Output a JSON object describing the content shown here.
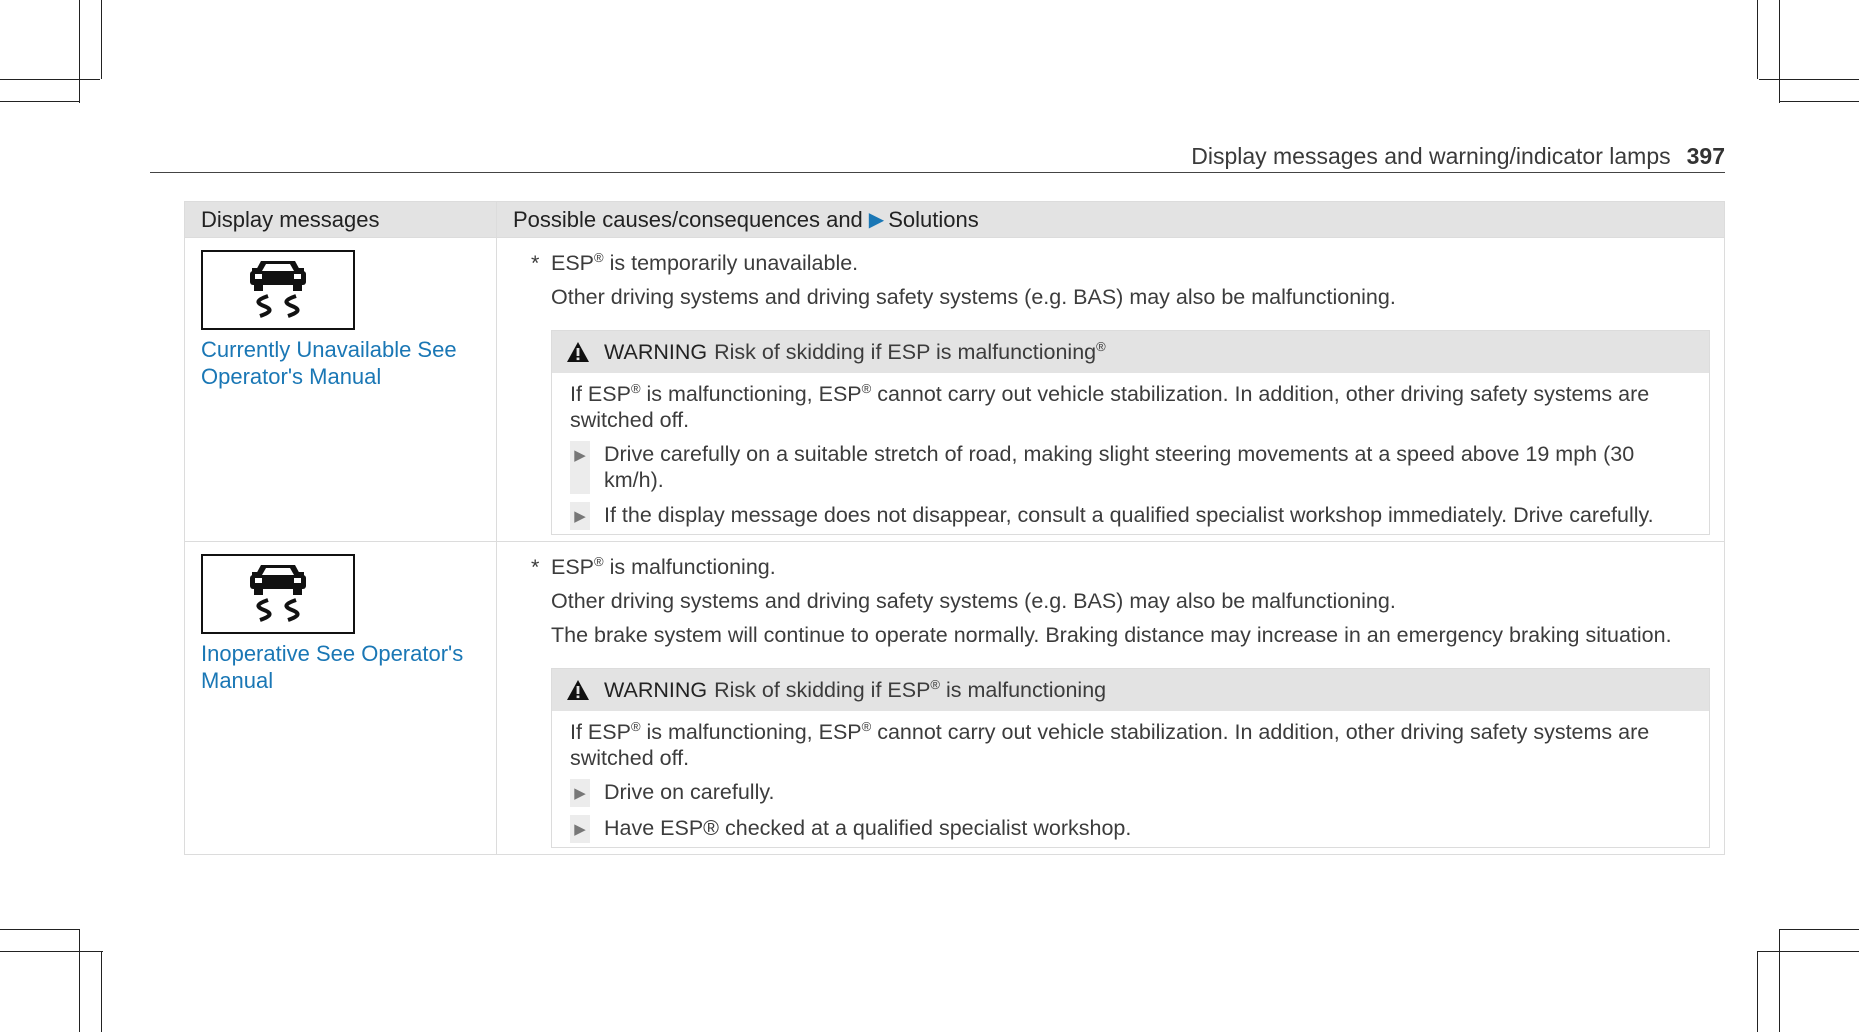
{
  "running_head": {
    "title": "Display messages and warning/indicator lamps",
    "page_number": "397"
  },
  "table": {
    "col1_header": "Display messages",
    "col2_header_pre": "Possible causes/consequences and",
    "col2_header_post": "Solutions",
    "rows": [
      {
        "icon": "esp-skid-car-icon",
        "message": "Currently Unavailable See Operator's Manual",
        "star": "*",
        "p1_pre": "ESP",
        "p1_post": " is temporarily unavailable.",
        "p2": "Other driving systems and driving safety systems (e.g. BAS) may also be malfunctioning.",
        "warning": {
          "label": "WARNING",
          "text_pre": "Risk of skidding if ESP is malfunctioning",
          "text_post": "",
          "body_a": "If ESP",
          "body_b": " is malfunctioning, ESP",
          "body_c": " cannot carry out vehicle stabilization. In addition, other driving safety systems are switched off.",
          "bullets": [
            "Drive carefully on a suitable stretch of road, making slight steering movements at a speed above 19 mph (30 km/h).",
            "If the display message does not disappear, consult a qualified specialist workshop immediately. Drive care­fully."
          ]
        }
      },
      {
        "icon": "esp-skid-car-icon",
        "message": "Inoperative See Operator's Manual",
        "star": "*",
        "p1_pre": "ESP",
        "p1_post": " is malfunctioning.",
        "p2": "Other driving systems and driving safety systems (e.g. BAS) may also be malfunctioning.",
        "p3": "The brake system will continue to operate normally. Braking distance may increase in an emergency braking situation.",
        "warning": {
          "label": "WARNING",
          "text_pre": "Risk of skidding if ESP",
          "text_post": " is malfunctioning",
          "body_a": "If ESP",
          "body_b": " is malfunctioning, ESP",
          "body_c": " cannot carry out vehicle stabilization. In addition, other driving safety systems are switched off.",
          "bullets": [
            "Drive on carefully.",
            "Have ESP® checked at a qualified specialist workshop."
          ]
        }
      }
    ]
  },
  "symbols": {
    "registered": "®",
    "bullet_marker": "▶",
    "warning_triangle": "warning-triangle-icon"
  },
  "colors": {
    "link_blue": "#1a77b5",
    "header_gray": "#e3e3e3"
  }
}
